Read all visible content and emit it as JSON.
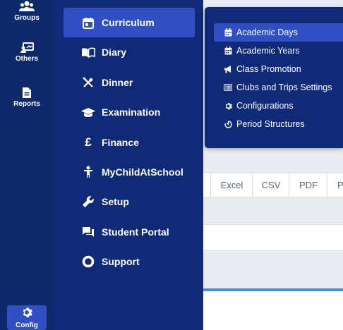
{
  "iconbar": {
    "groups_label": "Groups",
    "others_label": "Others",
    "reports_label": "Reports",
    "config_label": "Config",
    "icons": {
      "groups": "groups-icon",
      "others": "others-icon",
      "reports": "reports-icon",
      "config": "gear-icon"
    }
  },
  "menu": {
    "items": [
      {
        "label": "Curriculum",
        "icon": "calendar-icon"
      },
      {
        "label": "Diary",
        "icon": "book-icon"
      },
      {
        "label": "Dinner",
        "icon": "utensils-icon"
      },
      {
        "label": "Examination",
        "icon": "graduation-cap-icon"
      },
      {
        "label": "Finance",
        "icon": "pound-icon"
      },
      {
        "label": "MyChildAtSchool",
        "icon": "child-icon"
      },
      {
        "label": "Setup",
        "icon": "wrench-icon"
      },
      {
        "label": "Student Portal",
        "icon": "chat-icon"
      },
      {
        "label": "Support",
        "icon": "ring-icon"
      }
    ]
  },
  "submenu": {
    "items": [
      {
        "label": "Academic Days",
        "icon": "calendar-icon"
      },
      {
        "label": "Academic Years",
        "icon": "calendar-icon"
      },
      {
        "label": "Class Promotion",
        "icon": "megaphone-icon"
      },
      {
        "label": "Clubs and Trips Settings",
        "icon": "list-icon"
      },
      {
        "label": "Configurations",
        "icon": "gear-icon"
      },
      {
        "label": "Period Structures",
        "icon": "timer-icon"
      }
    ]
  },
  "export": {
    "buttons": [
      "Excel",
      "CSV",
      "PDF",
      "P"
    ]
  },
  "colors": {
    "iconbar_bg": "#0f2a6b",
    "menu_bg": "#102a78",
    "active_bg": "#2f4fc2",
    "accent_line": "#4a90e2"
  }
}
